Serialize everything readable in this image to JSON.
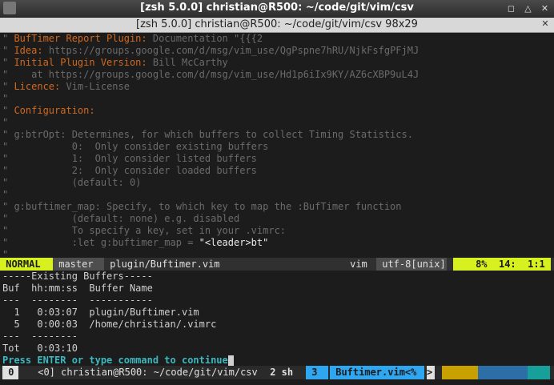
{
  "window": {
    "title": "[zsh 5.0.0] christian@R500: ~/code/git/vim/csv",
    "tab_title": "[zsh 5.0.0] christian@R500: ~/code/git/vim/csv 98x29",
    "minimize_icon": "minimize-icon",
    "maximize_icon": "maximize-icon",
    "close_icon": "close-icon"
  },
  "editor": {
    "lines": [
      {
        "q": "\"",
        "tag": " BufTimer Report Plugin:",
        "rest": " Documentation \"{{{2"
      },
      {
        "q": "\"",
        "tag": " Idea:",
        "rest": " https://groups.google.com/d/msg/vim_use/QgPspne7hRU/NjkFsfgPFjMJ"
      },
      {
        "q": "\"",
        "tag": " Initial Plugin Version:",
        "rest": " Bill McCarthy"
      },
      {
        "q": "\"",
        "tag": "",
        "rest": "    at https://groups.google.com/d/msg/vim_use/Hd1p6iIx9KY/AZ6cXBP9uL4J"
      },
      {
        "q": "\"",
        "tag": " Licence:",
        "rest": " Vim-License"
      },
      {
        "q": "\"",
        "tag": "",
        "rest": ""
      },
      {
        "q": "\"",
        "tag": " Configuration:",
        "rest": ""
      },
      {
        "q": "\"",
        "tag": "",
        "rest": ""
      },
      {
        "q": "\"",
        "tag": "",
        "rest": " g:btrOpt: Determines, for which buffers to collect Timing Statistics."
      },
      {
        "q": "\"",
        "tag": "",
        "rest": "           0:  Only consider existing buffers"
      },
      {
        "q": "\"",
        "tag": "",
        "rest": "           1:  Only consider listed buffers"
      },
      {
        "q": "\"",
        "tag": "",
        "rest": "           2:  Only consider loaded buffers"
      },
      {
        "q": "\"",
        "tag": "",
        "rest": "           (default: 0)"
      },
      {
        "q": "\"",
        "tag": "",
        "rest": ""
      },
      {
        "q": "\"",
        "tag": "",
        "rest": " g:buftimer_map: Specify, to which key to map the :BufTimer function"
      },
      {
        "q": "\"",
        "tag": "",
        "rest": "           (default: none) e.g. disabled"
      },
      {
        "q": "\"",
        "tag": "",
        "rest": "           To specify a key, set in your .vimrc:"
      },
      {
        "q": "\"",
        "tag": "",
        "rest": "           :let g:buftimer_map = ",
        "str": "\"<leader>bt\""
      },
      {
        "q": "\"",
        "tag": "",
        "rest": ""
      }
    ]
  },
  "statusline": {
    "mode": " NORMAL ",
    "branch": " master ",
    "file": " plugin/Buftimer.vim",
    "filetype": "vim ",
    "encoding": " utf-8[unix] ",
    "position": " 8%  14:  1:1 "
  },
  "output": {
    "lines": [
      "-----Existing Buffers-----",
      "Buf  hh:mm:ss  Buffer Name",
      "---  --------  -----------",
      "  1   0:03:07  plugin/Buftimer.vim",
      "  5   0:00:03  /home/christian/.vimrc",
      "---  --------",
      "Tot   0:03:10"
    ],
    "prompt": "Press ENTER or type command to continue"
  },
  "tmux": {
    "session": " 0 ",
    "window_info": " <0] christian@R500: ~/code/git/vim/csv ",
    "shell_count": " 2 sh ",
    "win_num": " 3 ",
    "win_name": " Buftimer.vim<% ",
    "arrow": ">",
    "colors": [
      "#c8a000",
      "#6a9a30",
      "#2e6ea6",
      "#17a09a"
    ]
  },
  "colors": {
    "background": "#1c1c1c",
    "comment": "#6b6b6b",
    "tag": "#d2691e",
    "mode_bg": "#d7f020",
    "prompt": "#3cb8c0",
    "tmux_blue": "#2ea6f0"
  }
}
